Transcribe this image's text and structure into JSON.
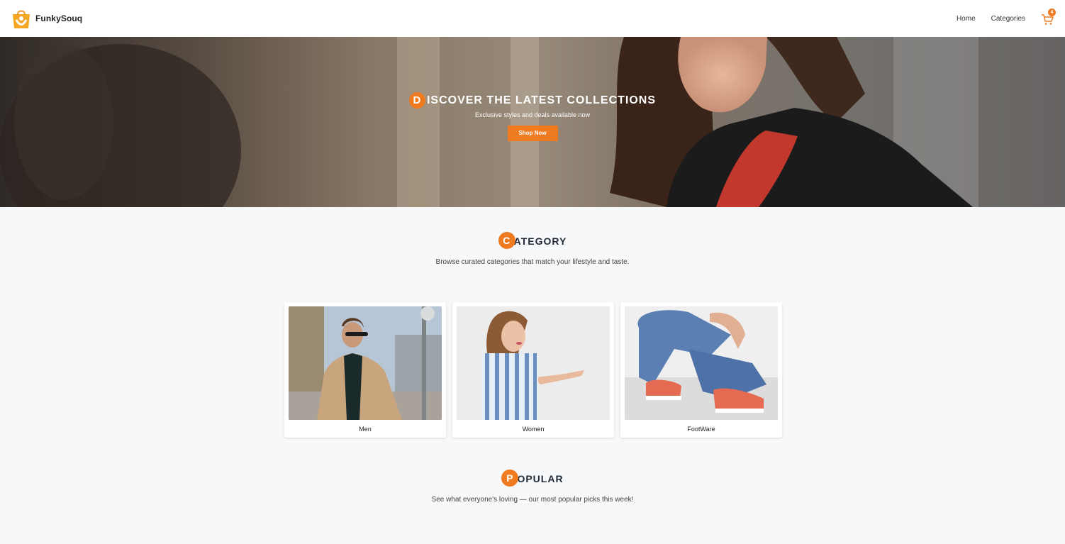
{
  "header": {
    "brand": "FunkySouq",
    "nav": [
      "Home",
      "Categories"
    ],
    "cart_count": "4"
  },
  "hero": {
    "title_initial": "D",
    "title_rest": "ISCOVER THE LATEST COLLECTIONS",
    "subtitle": "Exclusive styles and deals available now",
    "button": "Shop Now"
  },
  "category": {
    "title_initial": "C",
    "title_rest": "ATEGORY",
    "subtitle": "Browse curated categories that match your lifestyle and taste.",
    "items": [
      {
        "label": "Men"
      },
      {
        "label": "Women"
      },
      {
        "label": "FootWare"
      }
    ]
  },
  "popular": {
    "title_initial": "P",
    "title_rest": "OPULAR",
    "subtitle": "See what everyone's loving — our most popular picks this week!"
  },
  "colors": {
    "accent": "#f07a1f",
    "background": "#f7f8fa",
    "heading": "#1f2a37"
  }
}
